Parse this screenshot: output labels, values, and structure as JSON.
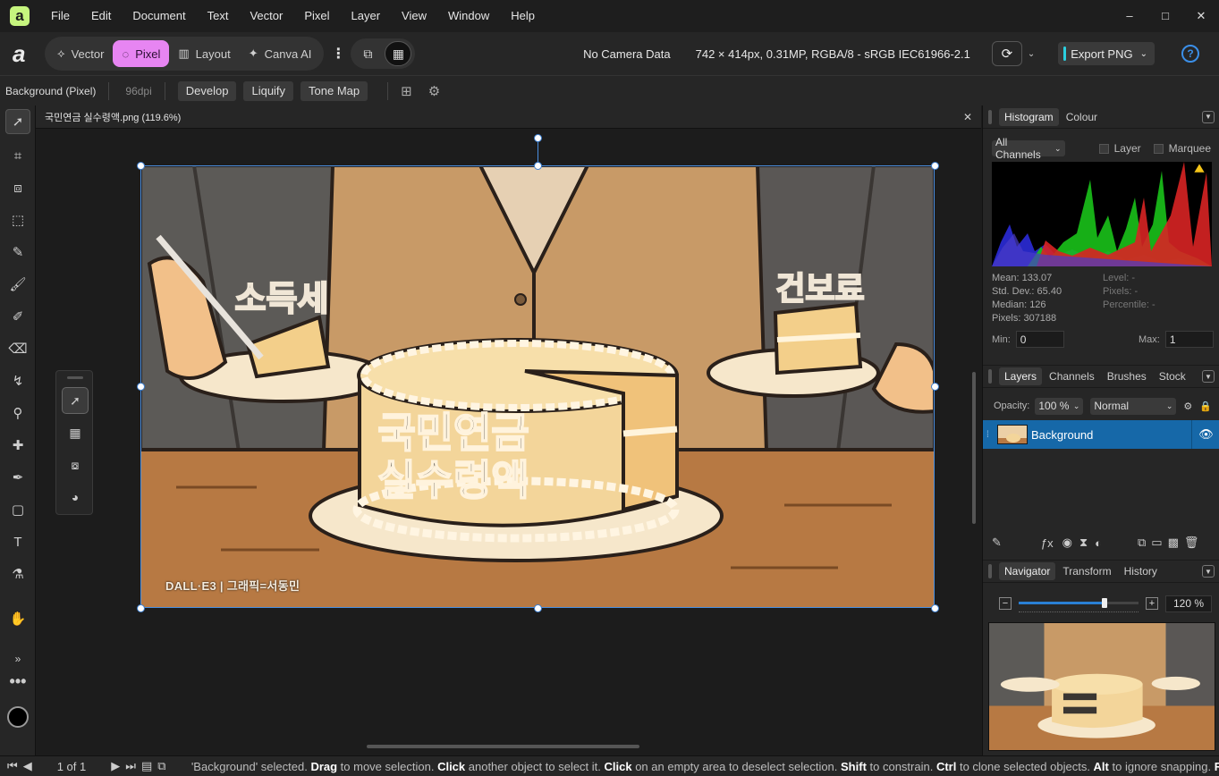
{
  "app": {
    "logo": "a",
    "brand": "a"
  },
  "menubar": {
    "items": [
      "File",
      "Edit",
      "Document",
      "Text",
      "Vector",
      "Pixel",
      "Layer",
      "View",
      "Window",
      "Help"
    ],
    "window_controls": {
      "minimize": "–",
      "maximize": "□",
      "close": "✕"
    }
  },
  "toolbar": {
    "personas": [
      {
        "label": "Vector",
        "icon": "vector-persona-icon"
      },
      {
        "label": "Pixel",
        "icon": "pixel-persona-icon",
        "active": true
      },
      {
        "label": "Layout",
        "icon": "layout-persona-icon"
      },
      {
        "label": "Canva AI",
        "icon": "canva-ai-icon"
      }
    ],
    "camera_data": "No Camera Data",
    "doc_info": "742 × 414px, 0.31MP, RGBA/8 - sRGB IEC61966-2.1",
    "export_label": "Export PNG",
    "help_label": "?"
  },
  "contextbar": {
    "layer_name": "Background (Pixel)",
    "dpi": "96dpi",
    "buttons": [
      "Develop",
      "Liquify",
      "Tone Map"
    ]
  },
  "document": {
    "tab_title": "국민연금 실수령액.png (119.6%)",
    "close": "✕"
  },
  "artwork": {
    "label_left": "소득세",
    "label_right": "건보료",
    "cake_text_line1": "국민연금",
    "cake_text_line2": "실수령액",
    "credit": "DALL·E3 | 그래픽=서동민"
  },
  "histogram_panel": {
    "tabs": [
      "Histogram",
      "Colour"
    ],
    "channel": "All Channels",
    "layer_label": "Layer",
    "marquee_label": "Marquee",
    "stats_left": [
      "Mean: 133.07",
      "Std. Dev.: 65.40",
      "Median: 126",
      "Pixels: 307188"
    ],
    "stats_right": [
      "Level: -",
      "Pixels: -",
      "Percentile: -"
    ],
    "min_label": "Min:",
    "min_value": "0",
    "max_label": "Max:",
    "max_value": "1"
  },
  "layers_panel": {
    "tabs": [
      "Layers",
      "Channels",
      "Brushes",
      "Stock"
    ],
    "opacity_label": "Opacity:",
    "opacity_value": "100 %",
    "blend_mode": "Normal",
    "layer_name": "Background"
  },
  "navigator_panel": {
    "tabs": [
      "Navigator",
      "Transform",
      "History"
    ],
    "zoom_value": "120 %",
    "zoom_fraction": 0.72
  },
  "statusbar": {
    "page": "1 of 1",
    "text_parts": [
      {
        "t": "'Background' selected. ",
        "b": false
      },
      {
        "t": "Drag",
        "b": true
      },
      {
        "t": " to move selection. ",
        "b": false
      },
      {
        "t": "Click",
        "b": true
      },
      {
        "t": " another object to select it. ",
        "b": false
      },
      {
        "t": "Click",
        "b": true
      },
      {
        "t": " on an empty area to deselect selection. ",
        "b": false
      },
      {
        "t": "Shift",
        "b": true
      },
      {
        "t": " to constrain. ",
        "b": false
      },
      {
        "t": "Ctrl",
        "b": true
      },
      {
        "t": " to clone selected objects. ",
        "b": false
      },
      {
        "t": "Alt",
        "b": true
      },
      {
        "t": " to ignore snapping. ",
        "b": false
      },
      {
        "t": "Return",
        "b": true
      }
    ]
  },
  "colors": {
    "pixel_accent": "#e785f2",
    "selection": "#1668a8",
    "export_accent": "#2bd0e0",
    "help": "#3b8fe8"
  }
}
